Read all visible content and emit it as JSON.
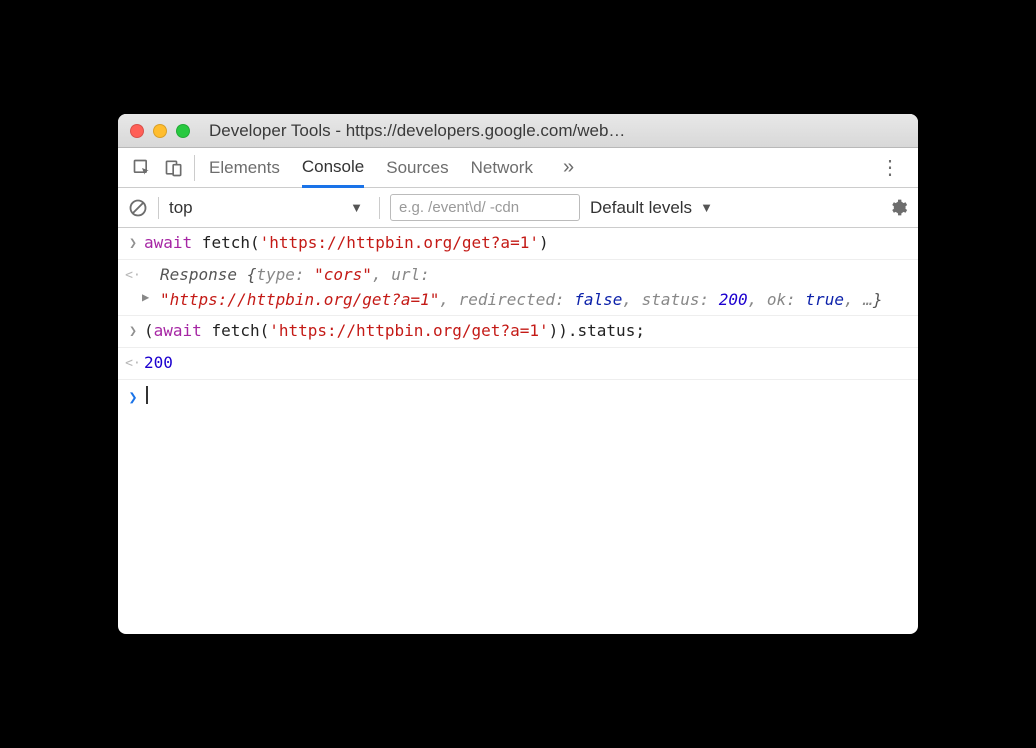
{
  "window": {
    "title": "Developer Tools - https://developers.google.com/web…"
  },
  "tabs": {
    "items": [
      "Elements",
      "Console",
      "Sources",
      "Network"
    ],
    "active": "Console",
    "overflow_glyph": "»"
  },
  "toolbar": {
    "context": "top",
    "filter_placeholder": "e.g. /event\\d/ -cdn",
    "levels": "Default levels"
  },
  "console": {
    "line1": {
      "kw": "await",
      "fn": " fetch(",
      "str": "'https://httpbin.org/get?a=1'",
      "close": ")"
    },
    "line2": {
      "cls": "Response ",
      "open": "{",
      "k_type": "type: ",
      "v_type": "\"cors\"",
      "sep1": ", ",
      "k_url": "url: ",
      "v_url": "\"https://httpbin.org/get?a=1\"",
      "sep2": ", ",
      "k_redir": "redirected: ",
      "v_redir": "false",
      "sep3": ", ",
      "k_status": "status: ",
      "v_status": "200",
      "sep4": ", ",
      "k_ok": "ok: ",
      "v_ok": "true",
      "sep5": ", ",
      "ellipsis": "…",
      "close": "}"
    },
    "line3": {
      "open": "(",
      "kw": "await",
      "fn": " fetch(",
      "str": "'https://httpbin.org/get?a=1'",
      "close1": ")",
      "close2": ")",
      "tail": ".status;"
    },
    "line4": {
      "value": "200"
    }
  }
}
